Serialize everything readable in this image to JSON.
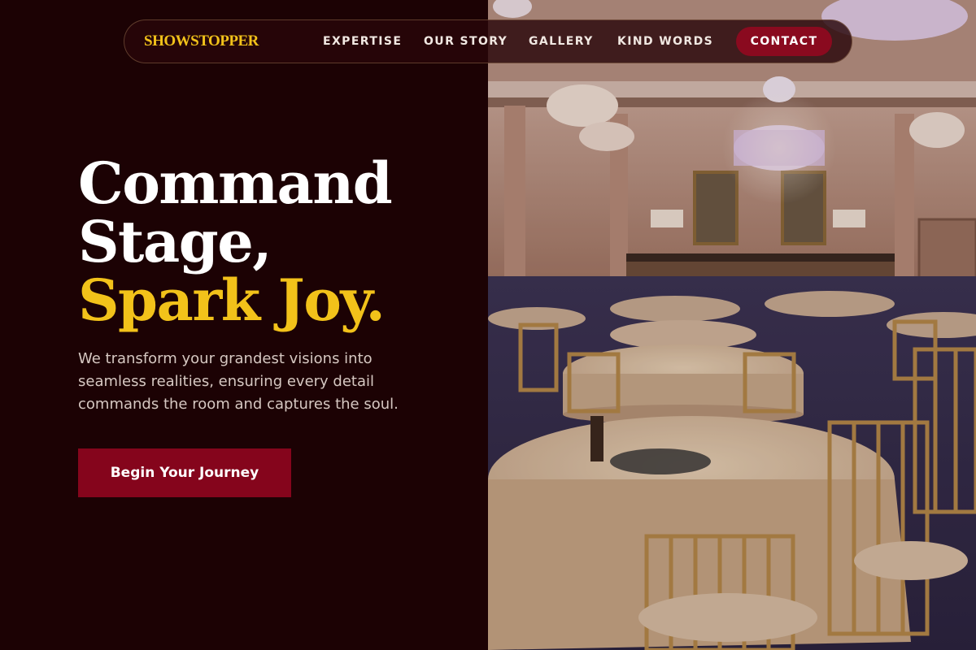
{
  "nav": {
    "brand": "SHOWSTOPPER",
    "links": [
      {
        "label": "EXPERTISE"
      },
      {
        "label": "OUR STORY"
      },
      {
        "label": "GALLERY"
      },
      {
        "label": "KIND WORDS"
      }
    ],
    "cta_label": "CONTACT"
  },
  "hero": {
    "headline_line1": "Command",
    "headline_line2": "Stage,",
    "headline_accent": "Spark Joy.",
    "subtext": "We transform your grandest visions into seamless realities, ensuring every detail commands the room and captures the soul.",
    "button_label": "Begin Your Journey"
  },
  "colors": {
    "background": "#1c0204",
    "accent_gold": "#f2c21a",
    "accent_crimson": "#85051c",
    "text_light": "#d6c8c2"
  }
}
